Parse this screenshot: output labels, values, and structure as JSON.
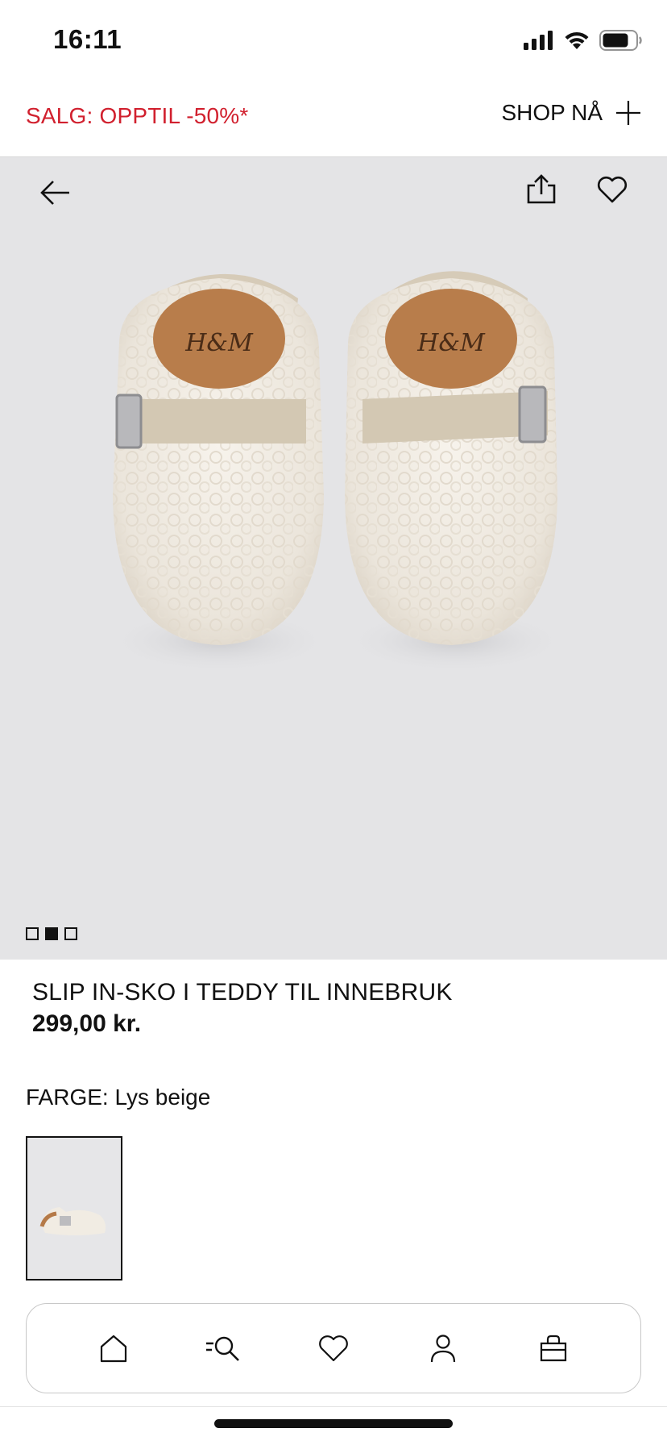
{
  "status": {
    "time": "16:11"
  },
  "promo": {
    "text": "SALG: OPPTIL -50%*",
    "link": "SHOP NÅ"
  },
  "product": {
    "name": "SLIP IN-SKO I TEDDY TIL INNEBRUK",
    "price": "299,00 kr.",
    "color_label": "FARGE:",
    "color_value": "Lys beige",
    "image_count": 3,
    "active_image": 2
  },
  "nav": {
    "items": [
      {
        "icon": "home-icon"
      },
      {
        "icon": "search-icon"
      },
      {
        "icon": "heart-icon"
      },
      {
        "icon": "user-icon"
      },
      {
        "icon": "bag-icon"
      }
    ]
  },
  "colors": {
    "promo": "#d1202e",
    "hero_bg": "#e4e4e6"
  }
}
